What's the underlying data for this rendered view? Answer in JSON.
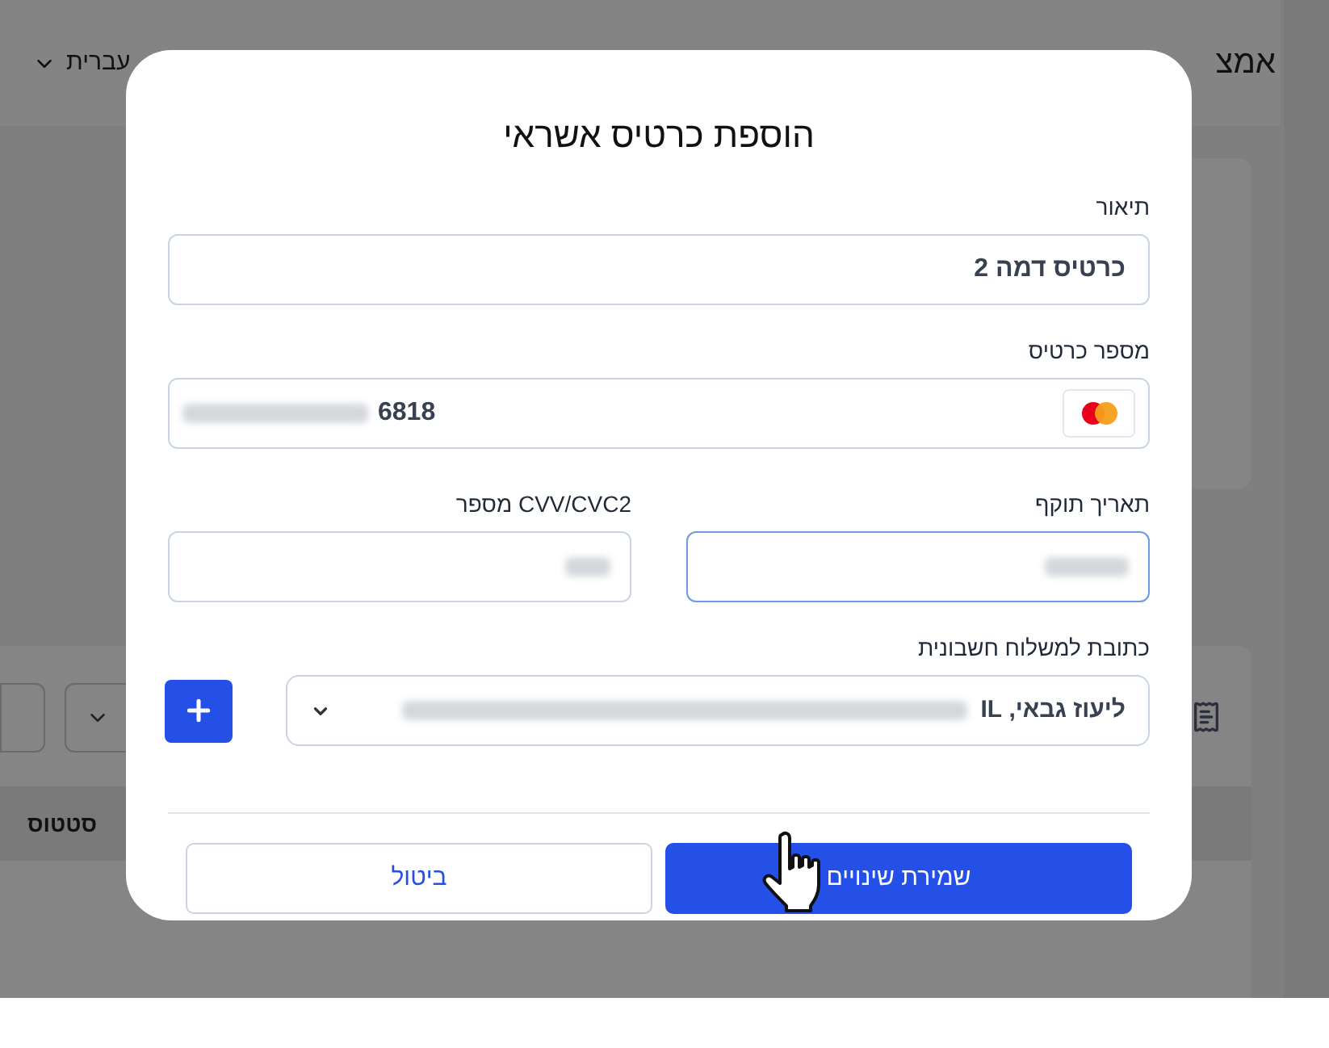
{
  "background": {
    "header_title": "אמצ",
    "language": "עברית",
    "table_column": "סטטוס"
  },
  "dialog": {
    "title": "הוספת כרטיס אשראי",
    "description": {
      "label": "תיאור",
      "value": "כרטיס דמה 2"
    },
    "card_number": {
      "label": "מספר כרטיס",
      "value": "6818"
    },
    "expiry": {
      "label": "תאריך תוקף",
      "focused": true
    },
    "cvv": {
      "label": "CVV/CVC2 מספר",
      "focused": false
    },
    "billing_address": {
      "label": "כתובת למשלוח חשבונית",
      "value": "ליעוז גבאי, IL"
    },
    "buttons": [
      {
        "kind": "primary",
        "label": "שמירת שינויים"
      },
      {
        "kind": "secondary",
        "label": "ביטול"
      }
    ]
  }
}
